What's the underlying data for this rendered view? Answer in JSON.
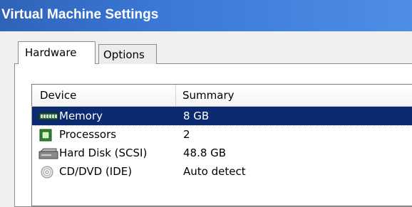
{
  "window": {
    "title": "Virtual Machine Settings"
  },
  "tabs": [
    {
      "label": "Hardware",
      "selected": true
    },
    {
      "label": "Options",
      "selected": false
    }
  ],
  "device_list": {
    "columns": [
      "Device",
      "Summary"
    ],
    "rows": [
      {
        "device": "Memory",
        "summary": "8 GB",
        "icon": "memory-icon",
        "selected": true
      },
      {
        "device": "Processors",
        "summary": "2",
        "icon": "processor-icon",
        "selected": false
      },
      {
        "device": "Hard Disk (SCSI)",
        "summary": "48.8 GB",
        "icon": "hard-disk-icon",
        "selected": false
      },
      {
        "device": "CD/DVD (IDE)",
        "summary": "Auto detect",
        "icon": "cd-dvd-icon",
        "selected": false
      }
    ]
  },
  "colors": {
    "title_bar": "#3b78d8",
    "selection": "#0b2a70"
  }
}
